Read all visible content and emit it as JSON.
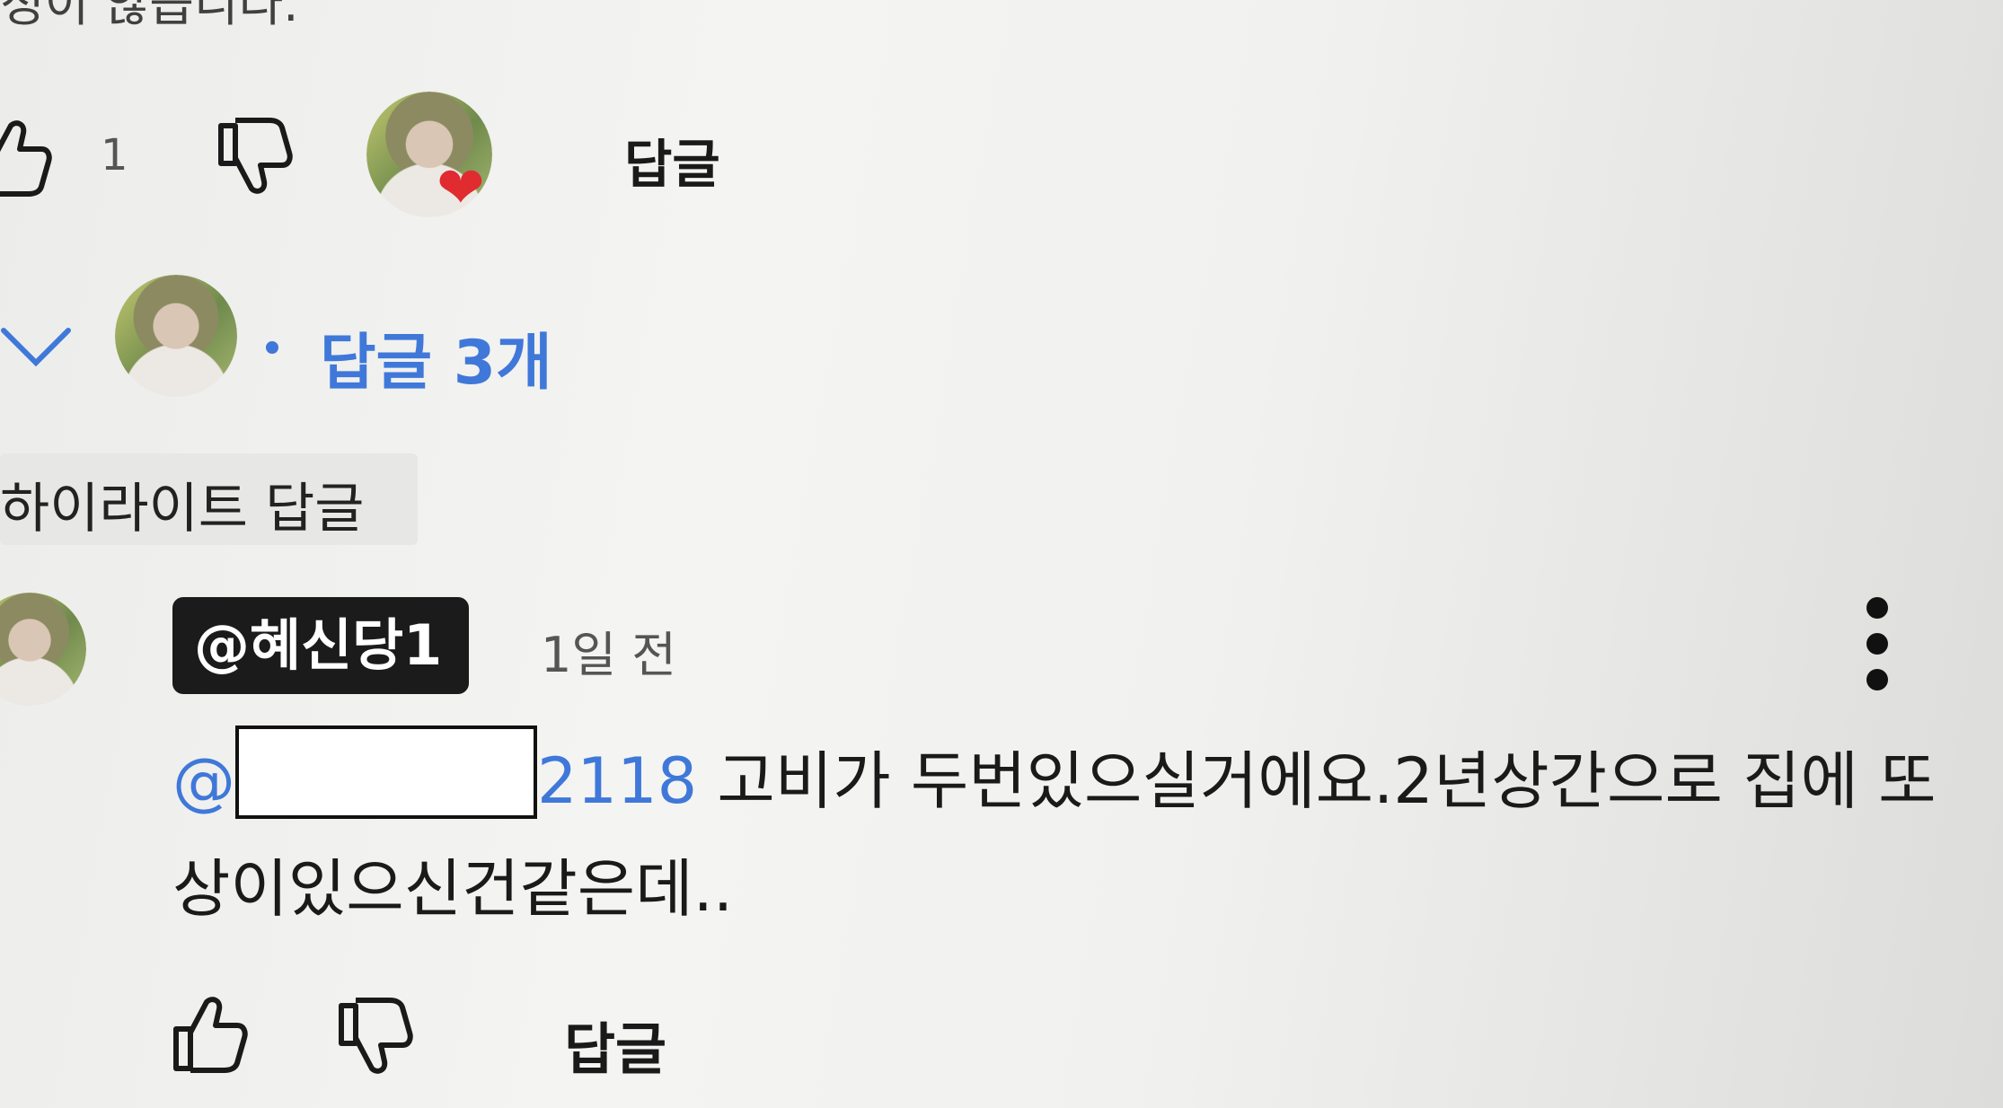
{
  "top_comment": {
    "partial_text": "정이 않습니다.",
    "like_count": "1",
    "reply_label": "답글",
    "creator_heart_icon": "heart-icon"
  },
  "replies_toggle": {
    "label": "답글 3개",
    "separator": "•",
    "chevron_icon": "chevron-down-icon"
  },
  "highlight": {
    "label": "하이라이트 답글"
  },
  "highlighted_reply": {
    "handle": "@혜신당1",
    "time": "1일 전",
    "mention_prefix": "@",
    "mention_suffix": "2118",
    "text": " 고비가 두번있으실거에요.2년상간으로 집에 또상이있으신건같은데..",
    "reply_label": "답글",
    "more_icon": "more-vertical-icon"
  },
  "colors": {
    "accent": "#3f78d9",
    "heart": "#e02b30",
    "badge": "#1b1b1b"
  }
}
